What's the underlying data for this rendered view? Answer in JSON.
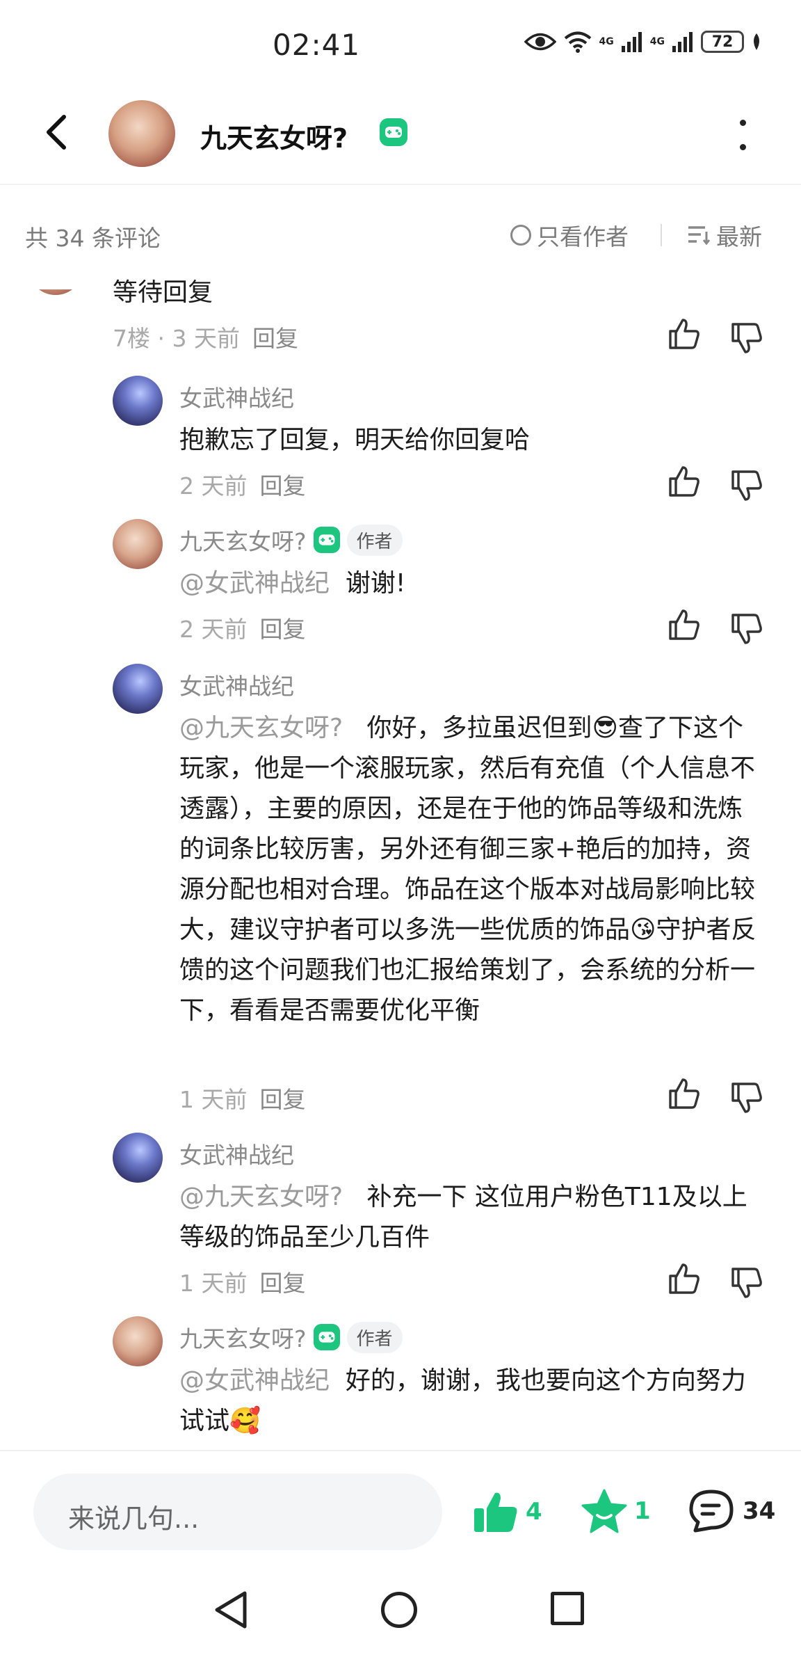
{
  "status_bar": {
    "time": "02:41",
    "network_1": "4G",
    "network_2": "4G",
    "battery": "72",
    "icons": [
      "eye-icon",
      "wifi-icon",
      "signal-icon",
      "signal-icon",
      "battery-icon",
      "leaf-icon"
    ]
  },
  "header": {
    "title": "九天玄女呀?",
    "back_icon": "chevron-left-icon",
    "more_icon": "more-vertical-icon",
    "brand_color": "#1dc67e"
  },
  "toolbar": {
    "comment_count": "共 34 条评论",
    "only_author": "只看作者",
    "sort": "最新"
  },
  "comments": [
    {
      "body": "等待回复",
      "meta": "7楼 · 3 天前",
      "reply": "回复"
    },
    {
      "name": "女武神战纪",
      "body": "抱歉忘了回复，明天给你回复哈",
      "meta": "2 天前",
      "reply": "回复"
    },
    {
      "name": "九天玄女呀?",
      "tag": "作者",
      "mention": "@女武神战纪",
      "body": "谢谢!",
      "meta": "2 天前",
      "reply": "回复"
    },
    {
      "name": "女武神战纪",
      "mention": "@九天玄女呀?",
      "body": "你好，多拉虽迟但到😎查了下这个玩家，他是一个滚服玩家，然后有充值（个人信息不透露），主要的原因，还是在于他的饰品等级和洗炼的词条比较厉害，另外还有御三家+艳后的加持，资源分配也相对合理。饰品在这个版本对战局影响比较大，建议守护者可以多洗一些优质的饰品😘守护者反馈的这个问题我们也汇报给策划了，会系统的分析一下，看看是否需要优化平衡",
      "meta": "1 天前",
      "reply": "回复"
    },
    {
      "name": "女武神战纪",
      "mention": "@九天玄女呀?",
      "body": "补充一下 这位用户粉色T11及以上等级的饰品至少几百件",
      "meta": "1 天前",
      "reply": "回复"
    },
    {
      "name": "九天玄女呀?",
      "tag": "作者",
      "mention": "@女武神战纪",
      "body": "好的，谢谢，我也要向这个方向努力试试🥰"
    }
  ],
  "bottom_bar": {
    "input_placeholder": "来说几句...",
    "like_count": "4",
    "star_count": "1",
    "comment_count": "34"
  }
}
